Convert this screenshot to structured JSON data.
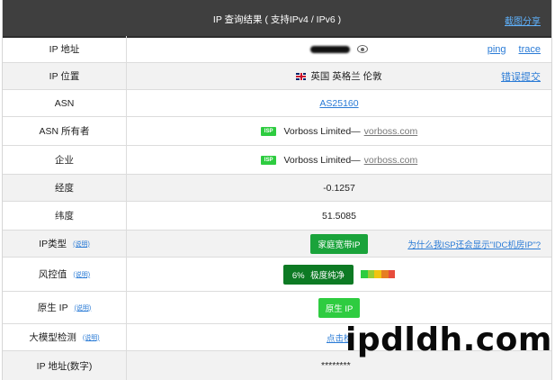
{
  "header": {
    "title": "IP 查询结果 ( 支持IPv4 / IPv6 )",
    "share": "截图分享"
  },
  "rows": {
    "ip": {
      "label": "IP 地址",
      "ping": "ping",
      "trace": "trace"
    },
    "location": {
      "label": "IP 位置",
      "value": "英国 英格兰 伦敦",
      "report": "错误提交"
    },
    "asn": {
      "label": "ASN",
      "value": "AS25160"
    },
    "asn_owner": {
      "label": "ASN 所有者",
      "badge": "ISP",
      "value": "Vorboss Limited—",
      "domain": "vorboss.com"
    },
    "company": {
      "label": "企业",
      "badge": "ISP",
      "value": "Vorboss Limited—",
      "domain": "vorboss.com"
    },
    "longitude": {
      "label": "经度",
      "value": "-0.1257"
    },
    "latitude": {
      "label": "纬度",
      "value": "51.5085"
    },
    "ip_type": {
      "label": "IP类型",
      "tip": "(说明)",
      "value": "家庭宽带IP",
      "question": "为什么我ISP还会显示\"IDC机房IP\"?"
    },
    "risk": {
      "label": "风控值",
      "tip": "(说明)",
      "value": "6%  极度纯净"
    },
    "native": {
      "label": "原生 IP",
      "tip": "(说明)",
      "value": "原生 IP"
    },
    "ai": {
      "label": "大模型检测",
      "tip": "(说明)",
      "value": "点击检"
    },
    "ip_numeric": {
      "label": "IP 地址(数字)",
      "value": "********"
    }
  },
  "risk_colors": [
    "#2ecc40",
    "#9acd32",
    "#f1c40f",
    "#e67e22",
    "#e74c3c"
  ],
  "watermark": "ipdldh.com"
}
